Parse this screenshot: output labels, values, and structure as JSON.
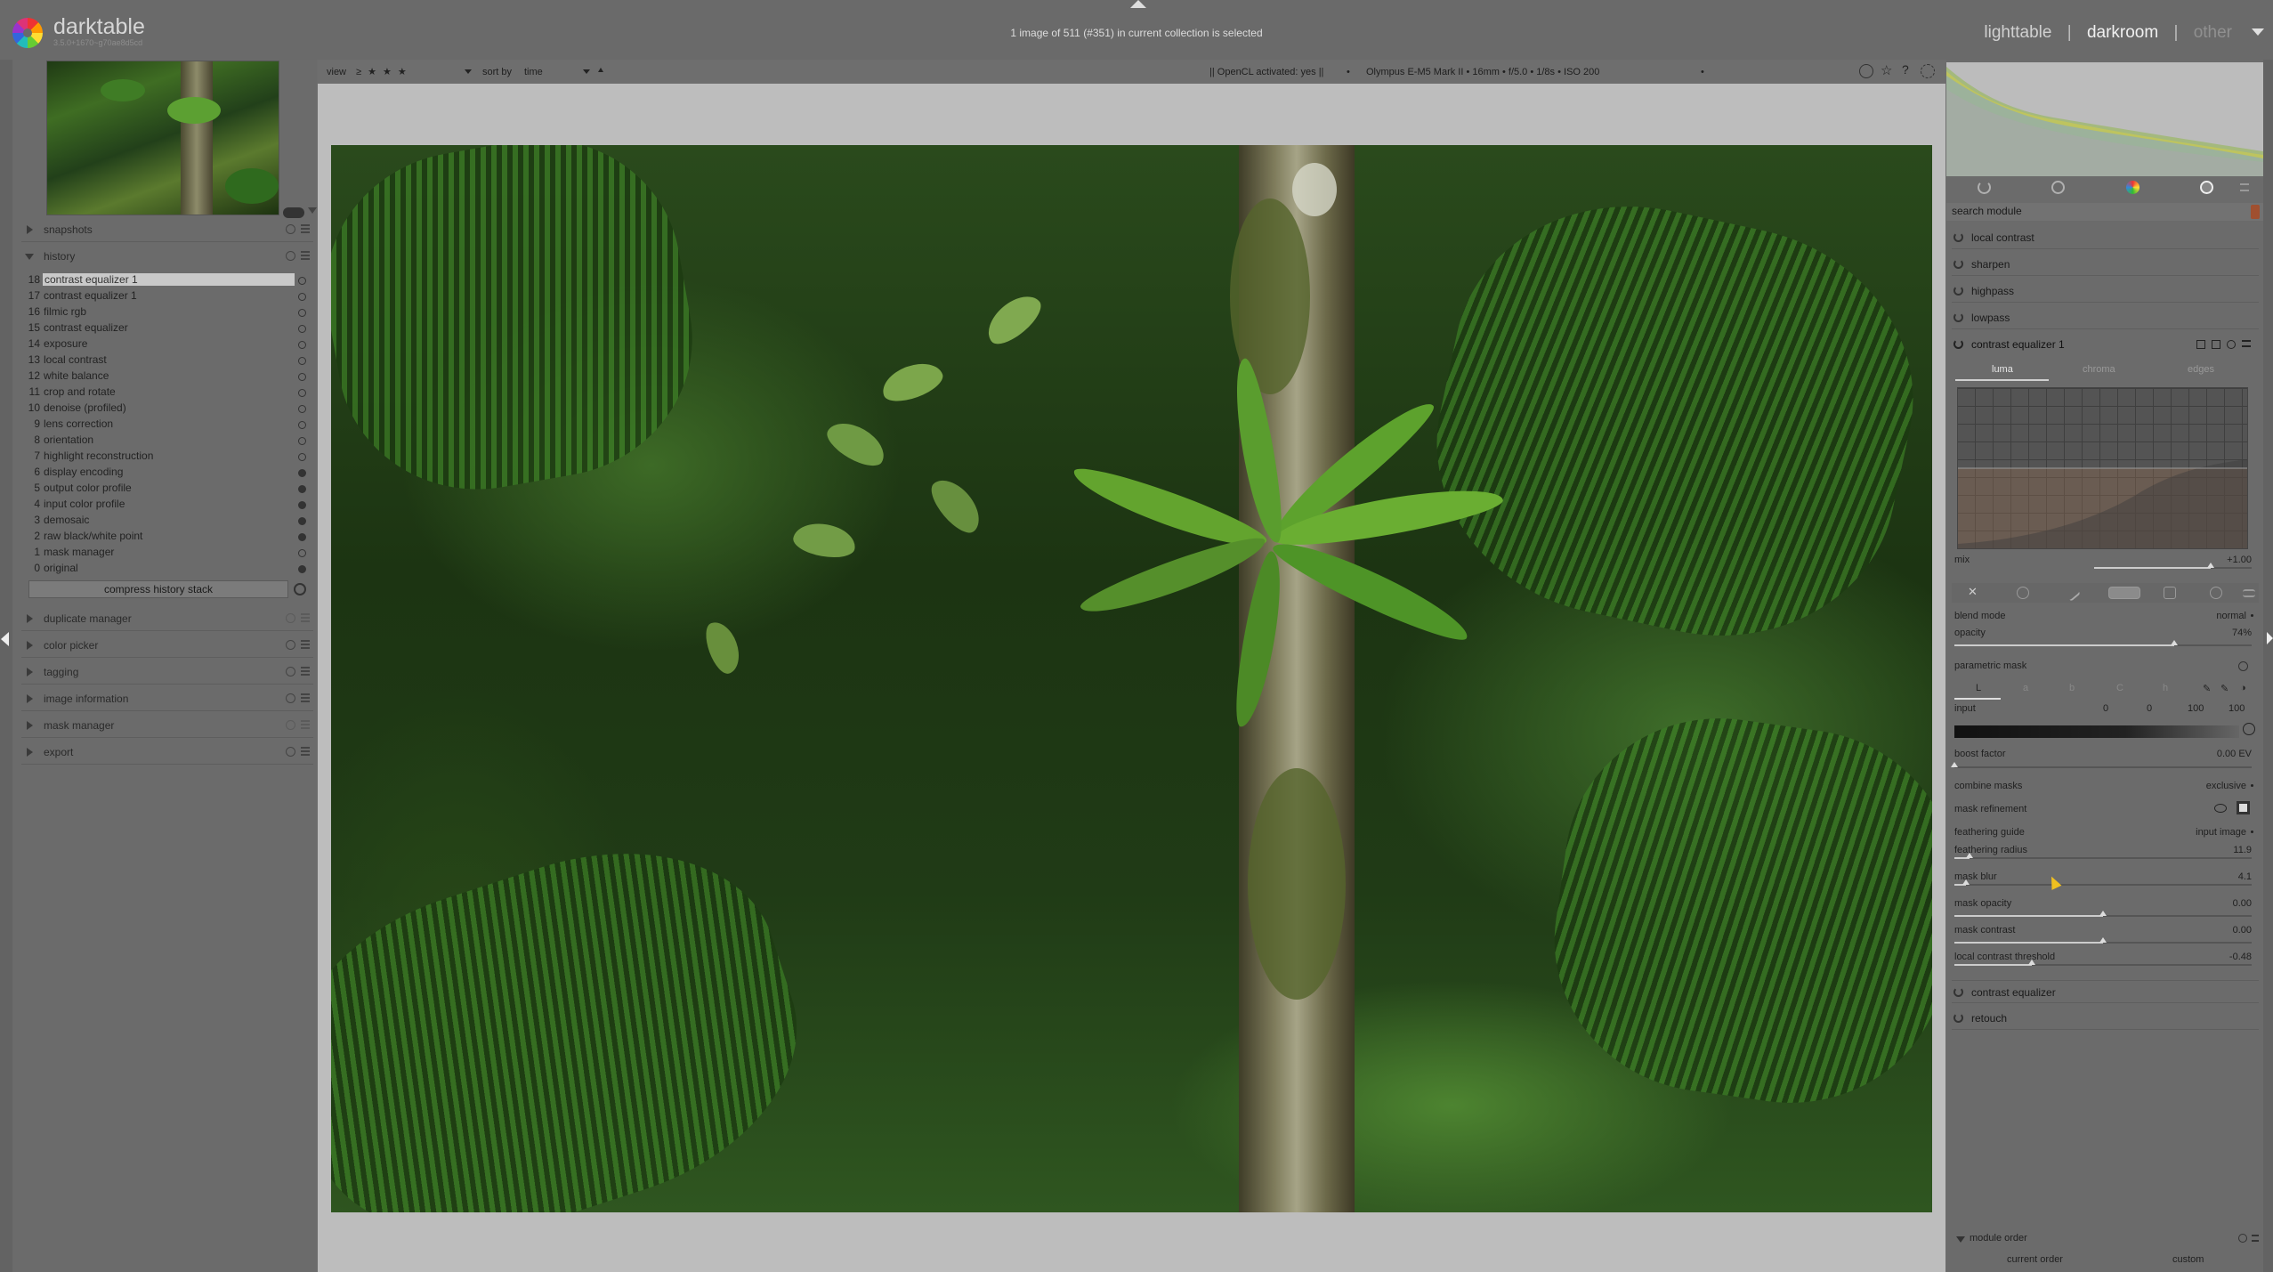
{
  "app": {
    "name": "darktable",
    "version": "3.5.0+1670~g70ae8d5cd"
  },
  "header": {
    "collection_info": "1 image of 511 (#351) in current collection is selected",
    "views": [
      "lighttable",
      "darkroom",
      "other"
    ],
    "view_separator": "|"
  },
  "toolbar": {
    "view_label": "view",
    "rating_filter": "≥ ★ ★ ★",
    "sort_label": "sort by",
    "sort_value": "time",
    "opencl": "|| OpenCL activated: yes ||",
    "camera_info": "Olympus E-M5 Mark II • 16mm • f/5.0 • 1/8s • ISO 200",
    "bullet": "•"
  },
  "left": {
    "sections_top": [
      {
        "label": "snapshots",
        "open": false
      },
      {
        "label": "history",
        "open": true
      }
    ],
    "history": [
      {
        "num": "18",
        "name": "contrast equalizer 1",
        "selected": true,
        "on": false
      },
      {
        "num": "17",
        "name": "contrast equalizer 1",
        "on": false
      },
      {
        "num": "16",
        "name": "filmic rgb",
        "on": false
      },
      {
        "num": "15",
        "name": "contrast equalizer",
        "on": false
      },
      {
        "num": "14",
        "name": "exposure",
        "on": false
      },
      {
        "num": "13",
        "name": "local contrast",
        "on": false
      },
      {
        "num": "12",
        "name": "white balance",
        "on": false
      },
      {
        "num": "11",
        "name": "crop and rotate",
        "on": false
      },
      {
        "num": "10",
        "name": "denoise (profiled)",
        "on": false
      },
      {
        "num": "9",
        "name": "lens correction",
        "on": false
      },
      {
        "num": "8",
        "name": "orientation",
        "on": false
      },
      {
        "num": "7",
        "name": "highlight reconstruction",
        "on": false
      },
      {
        "num": "6",
        "name": "display encoding",
        "on": true
      },
      {
        "num": "5",
        "name": "output color profile",
        "on": true
      },
      {
        "num": "4",
        "name": "input color profile",
        "on": true
      },
      {
        "num": "3",
        "name": "demosaic",
        "on": true
      },
      {
        "num": "2",
        "name": "raw black/white point",
        "on": true
      },
      {
        "num": "1",
        "name": "mask manager",
        "on": false
      },
      {
        "num": "0",
        "name": "original",
        "on": true
      }
    ],
    "compress_label": "compress history stack",
    "sections_bottom": [
      {
        "label": "duplicate manager"
      },
      {
        "label": "color picker"
      },
      {
        "label": "tagging"
      },
      {
        "label": "image information"
      },
      {
        "label": "mask manager"
      },
      {
        "label": "export"
      }
    ]
  },
  "right": {
    "search_placeholder": "search module",
    "modules_above": [
      "local contrast",
      "sharpen",
      "highpass",
      "lowpass"
    ],
    "active_module": "contrast equalizer 1",
    "ce_tabs": [
      "luma",
      "chroma",
      "edges"
    ],
    "mix": {
      "label": "mix",
      "value": "+1.00",
      "level": 0.74
    },
    "blend_mode": {
      "label": "blend mode",
      "value": "normal"
    },
    "opacity": {
      "label": "opacity",
      "value": "74%",
      "level": 0.74
    },
    "parametric_mask_label": "parametric mask",
    "channels": [
      "L",
      "a",
      "b",
      "C",
      "h"
    ],
    "input": {
      "label": "input",
      "values": [
        "0",
        "0",
        "100",
        "100"
      ]
    },
    "boost_factor": {
      "label": "boost factor",
      "value": "0.00 EV",
      "level": 0.0
    },
    "combine_masks": {
      "label": "combine masks",
      "value": "exclusive"
    },
    "mask_refinement_label": "mask refinement",
    "feathering_guide": {
      "label": "feathering guide",
      "value": "input image"
    },
    "feathering_radius": {
      "label": "feathering radius",
      "value": "11.9",
      "level": 0.05
    },
    "mask_blur": {
      "label": "mask blur",
      "value": "4.1",
      "level": 0.04
    },
    "mask_opacity": {
      "label": "mask opacity",
      "value": "0.00",
      "level": 0.5
    },
    "mask_contrast": {
      "label": "mask contrast",
      "value": "0.00",
      "level": 0.5
    },
    "local_contrast_threshold": {
      "label": "local contrast threshold",
      "value": "-0.48",
      "level": 0.26
    },
    "modules_below": [
      "contrast equalizer",
      "retouch"
    ],
    "module_order": {
      "label": "module order",
      "current": "current order",
      "custom": "custom"
    }
  },
  "colors": {
    "accent": "#f0c020",
    "panel": "#6b6b6b",
    "center": "#bdbdbd"
  },
  "icons": [
    "darktable-logo-icon",
    "power-icon",
    "presets-icon",
    "reset-icon",
    "star-icon",
    "help-icon",
    "gear-icon",
    "eye-icon",
    "color-picker-icon"
  ]
}
